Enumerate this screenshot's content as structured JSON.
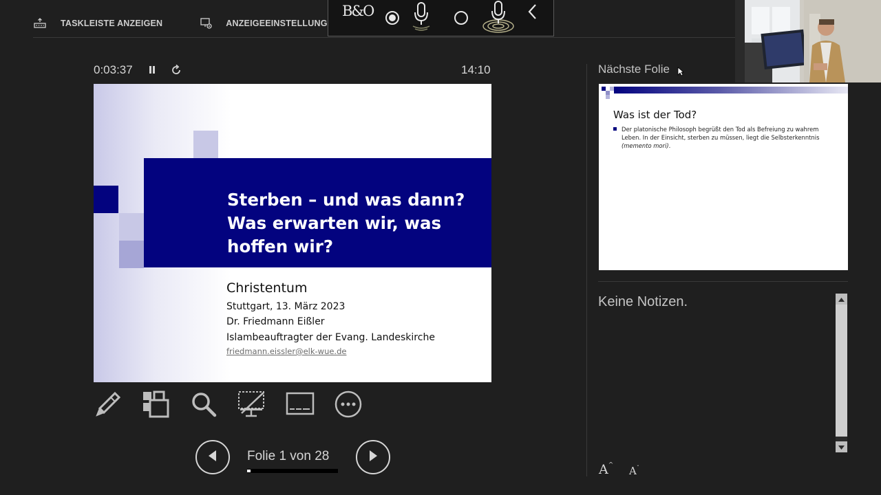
{
  "toolbar": {
    "taskbar_label": "TASKLEISTE ANZEIGEN",
    "display_label": "ANZEIGEEINSTELLUNGEN ▼"
  },
  "audio_overlay": {
    "logo": "B&O",
    "icons": [
      "record-selected-icon",
      "microphone-icon",
      "record-unselected-icon",
      "microphone-active-icon",
      "collapse-icon"
    ]
  },
  "presenter": {
    "elapsed": "0:03:37",
    "clock": "14:10"
  },
  "current_slide": {
    "title": "Sterben – und was dann? Was erwarten wir, was hoffen wir?",
    "subtitle": "Christentum",
    "lines": [
      "Stuttgart, 13. März 2023",
      "Dr. Friedmann Eißler",
      "Islambeauftragter der Evang. Landeskirche"
    ],
    "email": "friedmann.eissler@elk-wue.de",
    "colors": {
      "banner": "#03037f",
      "accent": "#8f8fc8"
    }
  },
  "tools": [
    "pen-icon",
    "slides-grid-icon",
    "zoom-icon",
    "black-screen-icon",
    "subtitles-icon",
    "more-options-icon"
  ],
  "navigation": {
    "counter": "Folie 1 von 28",
    "current": 1,
    "total": 28,
    "progress": 0.036
  },
  "next_slide": {
    "label": "Nächste Folie",
    "title": "Was ist der Tod?",
    "body": "Der platonische Philosoph begrüßt den Tod als Befreiung zu wahrem Leben. In der Einsicht, sterben zu müssen, liegt die Selbsterkenntnis",
    "body_italic": "(memento mori)",
    "body_end": "."
  },
  "notes": {
    "text": "Keine Notizen."
  },
  "font_controls": {
    "increase": "A",
    "decrease": "A"
  }
}
